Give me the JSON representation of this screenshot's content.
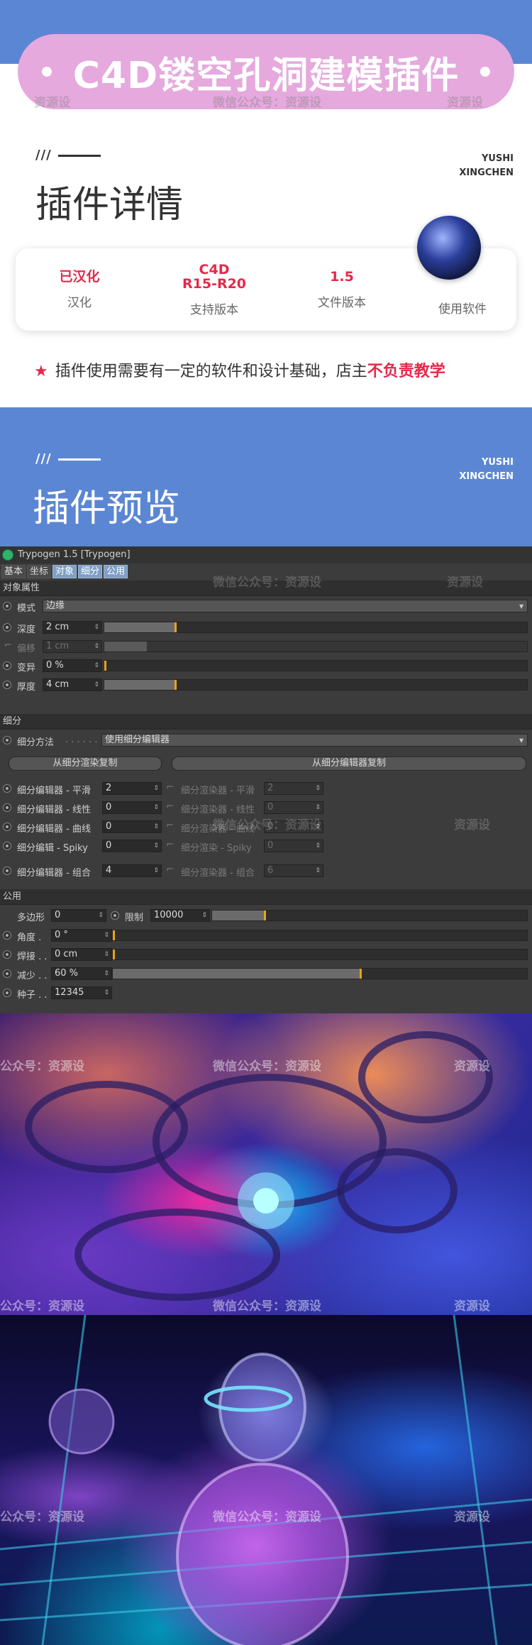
{
  "banner": {
    "title": "C4D镂空孔洞建模插件"
  },
  "watermark": {
    "text": "微信公众号：资源设",
    "partial_left": "资源设",
    "partial_edge": "公众号：资源设"
  },
  "details": {
    "mark": "///",
    "title": "插件详情",
    "brand_line1": "YUSHI",
    "brand_line2": "XINGCHEN",
    "items": [
      {
        "value": "已汉化",
        "label": "汉化"
      },
      {
        "value_line1": "C4D",
        "value_line2": "R15-R20",
        "label": "支持版本"
      },
      {
        "value": "1.5",
        "label": "文件版本"
      },
      {
        "label": "使用软件",
        "icon": "cinema4d-logo-icon"
      }
    ],
    "note_star": "★",
    "note_text": "插件使用需要有一定的软件和设计基础，店主",
    "note_highlight": "不负责教学"
  },
  "preview": {
    "mark": "///",
    "title": "插件预览",
    "brand_line1": "YUSHI",
    "brand_line2": "XINGCHEN"
  },
  "panel": {
    "title": "Trypogen 1.5 [Trypogen]",
    "tabs": [
      "基本",
      "坐标",
      "对象",
      "细分",
      "公用"
    ],
    "active_tabs": [
      2,
      3,
      4
    ],
    "group_object": "对象属性",
    "mode_label": "模式",
    "mode_value": "边缘",
    "depth": {
      "label": "深度",
      "value": "2 cm",
      "slider": 0.17
    },
    "offset": {
      "label": "偏移",
      "value": "1 cm",
      "slider": 0.1
    },
    "variation": {
      "label": "变异",
      "value": "0 %",
      "slider": 0.0
    },
    "thickness": {
      "label": "厚度",
      "value": "4 cm",
      "slider": 0.17
    },
    "group_subdiv": "细分",
    "subdiv_method_label": "细分方法",
    "subdiv_method_value": "使用细分编辑器",
    "copy_from_render": "从细分渲染复制",
    "copy_from_editor": "从细分编辑器复制",
    "editor_rows": [
      {
        "label": "细分编辑器 - 平滑",
        "value": "2",
        "r_label": "细分渲染器 - 平滑",
        "r_value": "2"
      },
      {
        "label": "细分编辑器 - 线性",
        "value": "0",
        "r_label": "细分渲染器 - 线性",
        "r_value": "0"
      },
      {
        "label": "细分编辑器 - 曲线",
        "value": "0",
        "r_label": "细分渲染器 - 曲线",
        "r_value": "0"
      },
      {
        "label": "细分编辑 -  Spiky",
        "value": "0",
        "r_label": "细分渲染 -  Spiky",
        "r_value": "0"
      },
      {
        "label": "细分编辑器 - 组合",
        "value": "4",
        "r_label": "细分渲染器 - 组合",
        "r_value": "6"
      }
    ],
    "group_common": "公用",
    "polygon_label": "多边形",
    "polygon_value": "0",
    "limit_label": "限制",
    "limit_value": "10000",
    "limit_slider": 0.17,
    "angle": {
      "label": "角度 .",
      "value": "0 °",
      "slider": 0.0
    },
    "weld": {
      "label": "焊接 . .",
      "value": "0 cm",
      "slider": 0.0
    },
    "reduce": {
      "label": "减少 . .",
      "value": "60 %",
      "slider": 0.6
    },
    "seed": {
      "label": "种子 . .",
      "value": "12345"
    }
  },
  "colors": {
    "band": "#5b86d3",
    "pill": "#e5a9dd",
    "accent_red": "#e5294a",
    "slider_knob": "#e8a21c"
  }
}
